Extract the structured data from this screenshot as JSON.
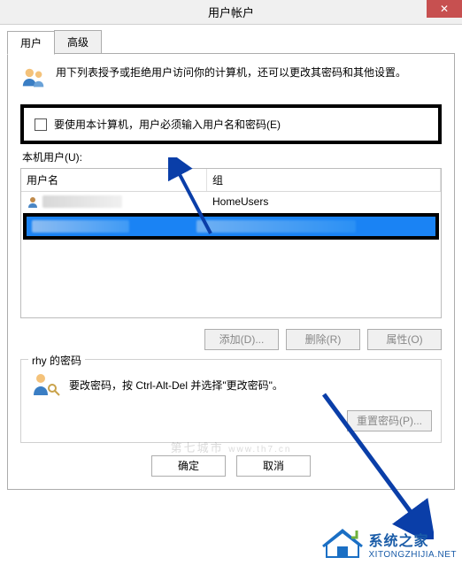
{
  "title": "用户帐户",
  "tabs": {
    "users": "用户",
    "advanced": "高级"
  },
  "intro": "用下列表授予或拒绝用户访问你的计算机，还可以更改其密码和其他设置。",
  "require_login_label": "要使用本计算机，用户必须输入用户名和密码(E)",
  "users_section_label": "本机用户(U):",
  "columns": {
    "username": "用户名",
    "group": "组"
  },
  "rows": {
    "r1_group": "HomeUsers"
  },
  "buttons": {
    "add": "添加(D)...",
    "remove": "删除(R)",
    "properties": "属性(O)"
  },
  "password_section": {
    "legend": "rhy 的密码",
    "text": "要改密码，按 Ctrl-Alt-Del 并选择\"更改密码\"。",
    "reset": "重置密码(P)..."
  },
  "bottom": {
    "ok": "确定",
    "cancel": "取消"
  },
  "watermarks": {
    "center": "第七城市",
    "brand_cn": "系统之家",
    "brand_url": "XITONGZHIJIA.NET",
    "top_url": "www.th7.cn"
  }
}
